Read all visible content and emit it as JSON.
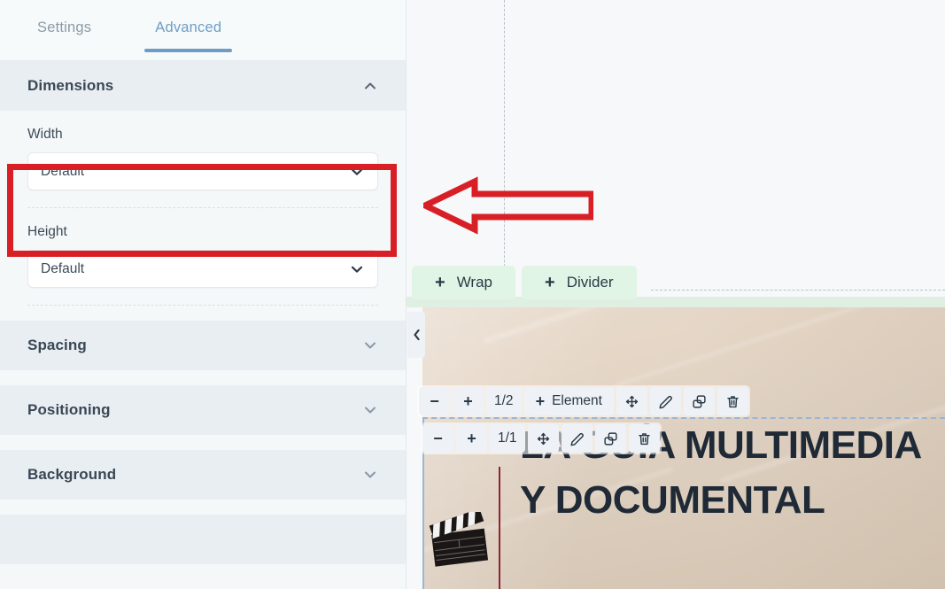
{
  "sidebar": {
    "tabs": [
      {
        "label": "Settings",
        "active": false
      },
      {
        "label": "Advanced",
        "active": true
      }
    ],
    "sections": [
      {
        "title": "Dimensions",
        "expanded": true,
        "chevron_icon": "chevron-up-icon",
        "fields": [
          {
            "label": "Width",
            "value": "Default",
            "caret_icon": "chevron-down-icon"
          },
          {
            "label": "Height",
            "value": "Default",
            "caret_icon": "chevron-down-icon"
          }
        ]
      },
      {
        "title": "Spacing",
        "expanded": false,
        "chevron_icon": "chevron-down-icon"
      },
      {
        "title": "Positioning",
        "expanded": false,
        "chevron_icon": "chevron-down-icon"
      },
      {
        "title": "Background",
        "expanded": false,
        "chevron_icon": "chevron-down-icon"
      }
    ]
  },
  "canvas": {
    "add_buttons": [
      {
        "label": "Wrap",
        "icon": "plus-icon"
      },
      {
        "label": "Divider",
        "icon": "plus-icon"
      }
    ],
    "collapse_toggle": {
      "icon": "chevron-left-icon"
    },
    "section_toolbar": {
      "decrease": "−",
      "increase": "+",
      "fraction": "1/2",
      "add_label": "Element",
      "add_icon": "plus-icon",
      "actions": [
        {
          "icon": "move-icon"
        },
        {
          "icon": "edit-pencil-icon"
        },
        {
          "icon": "duplicate-icon"
        },
        {
          "icon": "trash-icon"
        }
      ]
    },
    "element_toolbar": {
      "decrease": "−",
      "increase": "+",
      "fraction": "1/1",
      "actions": [
        {
          "icon": "move-icon"
        },
        {
          "icon": "edit-pencil-icon"
        },
        {
          "icon": "duplicate-icon"
        },
        {
          "icon": "trash-icon"
        }
      ]
    },
    "heading_text": "LA GUÍA MULTIMEDIA Y DOCUMENTAL",
    "media_icon": "clapperboard-icon"
  },
  "annotations": {
    "highlight_box": {
      "color": "#d81f26"
    },
    "arrow": {
      "color": "#d81f26",
      "direction": "left"
    }
  },
  "colors": {
    "accent_tab": "#6d9dc5",
    "section_header_bg": "#e9eef3",
    "add_button_bg": "#e1f5e6",
    "annotation_red": "#d81f26",
    "maroon_rule": "#8e2338",
    "selection_blue": "#9ab6d4"
  }
}
